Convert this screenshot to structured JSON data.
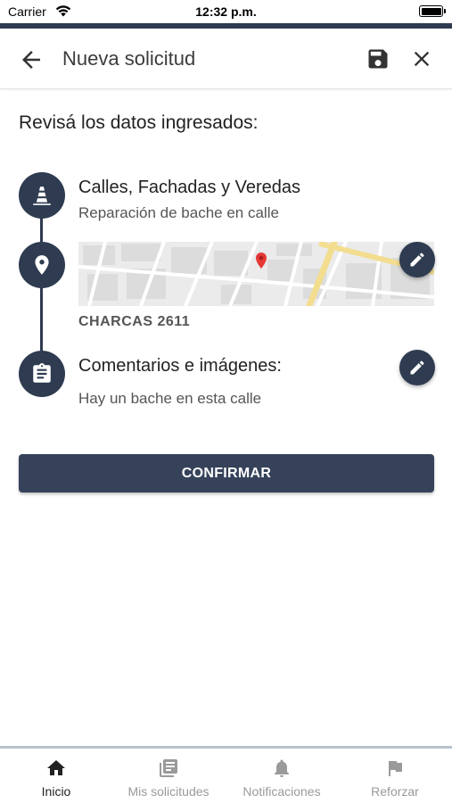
{
  "status_bar": {
    "carrier": "Carrier",
    "time": "12:32 p.m."
  },
  "header": {
    "title": "Nueva solicitud"
  },
  "review": {
    "heading": "Revisá los datos ingresados:",
    "category": {
      "title": "Calles, Fachadas y Veredas",
      "subtitle": "Reparación de bache en calle"
    },
    "location": {
      "address": "CHARCAS 2611"
    },
    "comments": {
      "title": "Comentarios e imágenes:",
      "text": "Hay un bache en esta calle"
    }
  },
  "confirm_label": "CONFIRMAR",
  "bottom_nav": [
    {
      "label": "Inicio",
      "icon": "home-icon",
      "active": true
    },
    {
      "label": "Mis solicitudes",
      "icon": "newspaper-icon",
      "active": false
    },
    {
      "label": "Notificaciones",
      "icon": "bell-icon",
      "active": false
    },
    {
      "label": "Reforzar",
      "icon": "flag-icon",
      "active": false
    }
  ],
  "colors": {
    "primary": "#2e3b50",
    "button": "#354259",
    "map_marker": "#e53935",
    "nav_border": "#b7c2cc"
  }
}
